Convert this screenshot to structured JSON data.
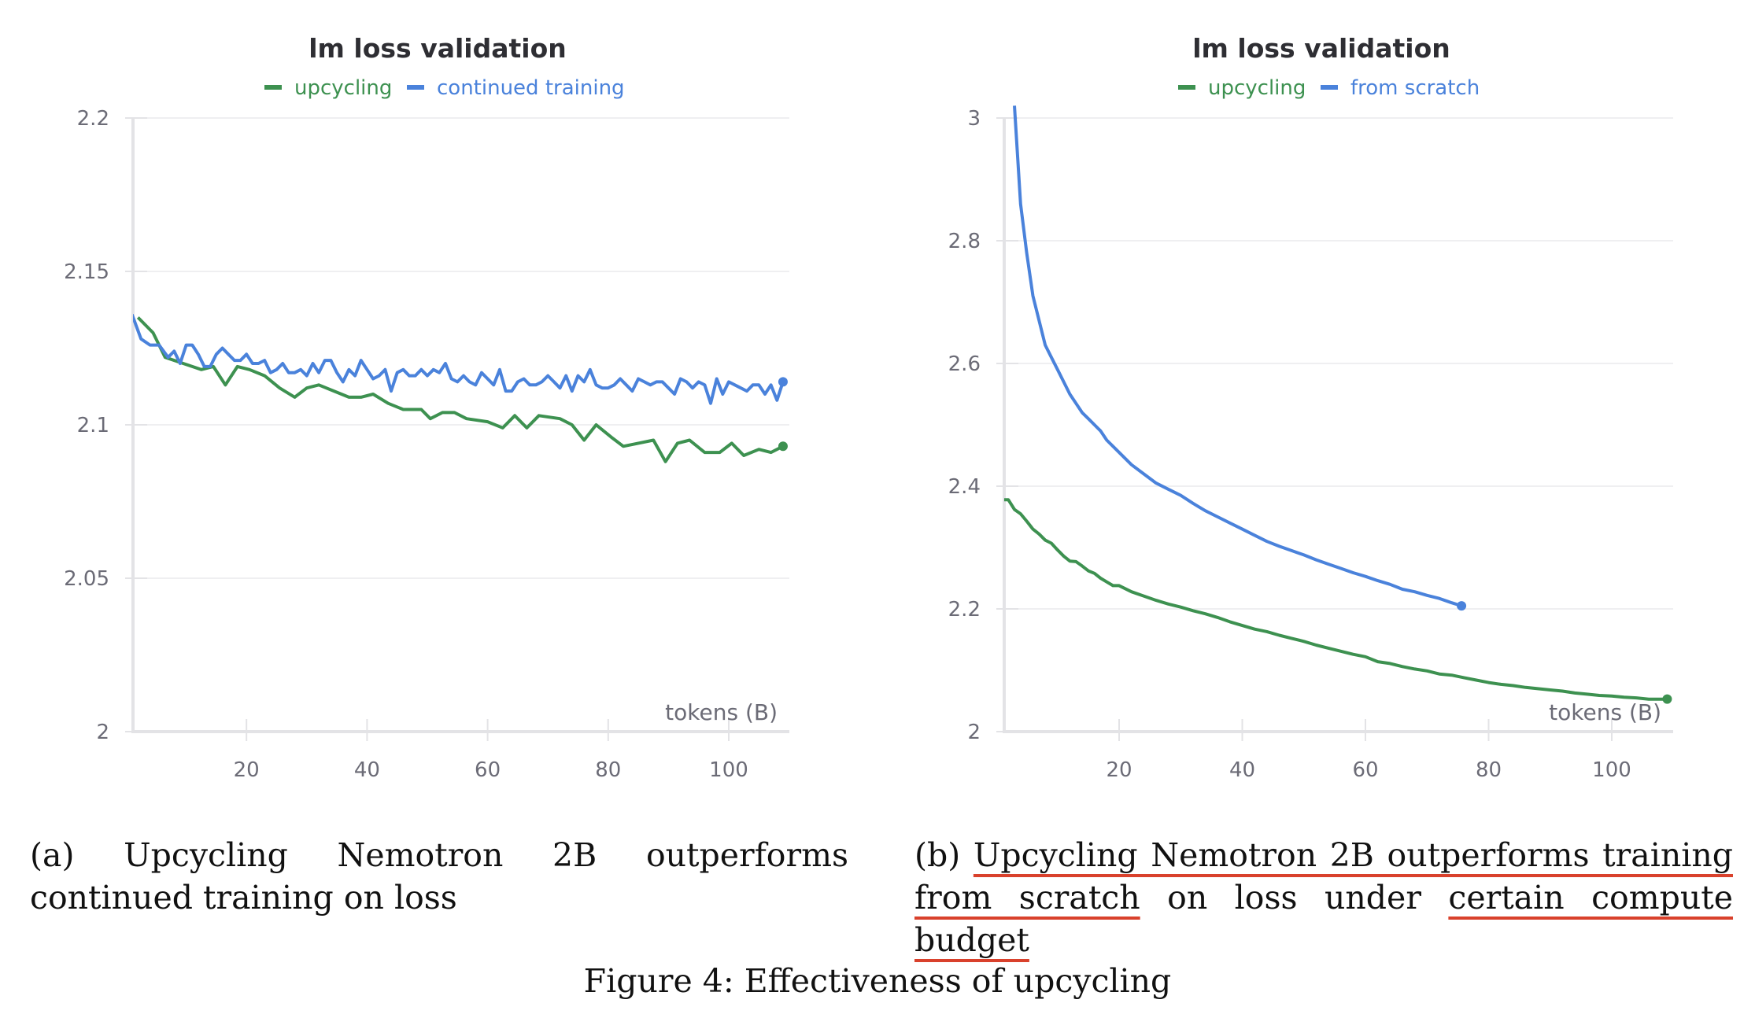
{
  "figure_caption": "Figure 4: Effectiveness of upcycling",
  "subcaptions": [
    {
      "label": "(a)",
      "text": "Upcycling Nemotron 2B outperforms continued training on loss",
      "segments": [
        {
          "text": "Upcycling Nemotron 2B outperforms continued training on loss",
          "underlined": false
        }
      ]
    },
    {
      "label": "(b)",
      "text": "Upcycling Nemotron 2B outperforms training from scratch on loss under certain compute budget",
      "segments": [
        {
          "text": "Upcycling Nemotron 2B outperforms training from scratch",
          "underlined": true
        },
        {
          "text": " on loss under ",
          "underlined": false
        },
        {
          "text": "certain compute budget",
          "underlined": true
        }
      ],
      "underline_color": "#d9412c"
    }
  ],
  "chart_data": [
    {
      "type": "line",
      "title": "lm loss validation",
      "xlabel": "tokens (B)",
      "ylabel": "",
      "xlim": [
        0,
        110
      ],
      "ylim": [
        2.0,
        2.2
      ],
      "xticks": [
        20,
        40,
        60,
        80,
        100
      ],
      "yticks": [
        2.0,
        2.05,
        2.1,
        2.15,
        2.2
      ],
      "ytick_labels": [
        "2",
        "2.05",
        "2.1",
        "2.15",
        "2.2"
      ],
      "grid": true,
      "legend_position": "top-center",
      "series": [
        {
          "name": "upcycling",
          "color": "#3d9150",
          "end_marker": true,
          "x": [
            2,
            4.5,
            6.5,
            9.5,
            12.5,
            14.5,
            16.5,
            18.5,
            20.5,
            23,
            25.5,
            28,
            30,
            32,
            34.5,
            37,
            39,
            41,
            43.5,
            46,
            49,
            50.5,
            52.5,
            54.5,
            56.5,
            60,
            62.5,
            64.5,
            66.5,
            68.5,
            72,
            74,
            76,
            78,
            80.5,
            82.5,
            85,
            87.5,
            89.5,
            91.5,
            93.5,
            96,
            98.5,
            100.5,
            102.5,
            105,
            107,
            109
          ],
          "y": [
            2.135,
            2.13,
            2.122,
            2.12,
            2.118,
            2.119,
            2.113,
            2.119,
            2.118,
            2.116,
            2.112,
            2.109,
            2.112,
            2.113,
            2.111,
            2.109,
            2.109,
            2.11,
            2.107,
            2.105,
            2.105,
            2.102,
            2.104,
            2.104,
            2.102,
            2.101,
            2.099,
            2.103,
            2.099,
            2.103,
            2.102,
            2.1,
            2.095,
            2.1,
            2.096,
            2.093,
            2.094,
            2.095,
            2.088,
            2.094,
            2.095,
            2.091,
            2.091,
            2.094,
            2.09,
            2.092,
            2.091,
            2.093,
            2.088,
            2.087
          ]
        },
        {
          "name": "continued training",
          "color": "#4a82db",
          "end_marker": true,
          "x": [
            1,
            2.5,
            4,
            5.5,
            7,
            8,
            9,
            10,
            11,
            12,
            13,
            14,
            15,
            16,
            17,
            18,
            19,
            20,
            21,
            22,
            23,
            24,
            25,
            26,
            27,
            28,
            29,
            30,
            31,
            32,
            33,
            34,
            35,
            36,
            37,
            38,
            39,
            40,
            41,
            42,
            43,
            44,
            45,
            46,
            47,
            48,
            49,
            50,
            51,
            52,
            53,
            54,
            55,
            56,
            57,
            58,
            59,
            60,
            61,
            62,
            63,
            64,
            65,
            66,
            67,
            68,
            69,
            70,
            71,
            72,
            73,
            74,
            75,
            76,
            77,
            78,
            79,
            80,
            81,
            82,
            83,
            84,
            85,
            86,
            87,
            88,
            89,
            90,
            91,
            92,
            93,
            94,
            95,
            96,
            97,
            98,
            99,
            100,
            101,
            102,
            103,
            104,
            105,
            106,
            107,
            108,
            109
          ],
          "y": [
            2.136,
            2.128,
            2.126,
            2.126,
            2.122,
            2.124,
            2.12,
            2.126,
            2.126,
            2.123,
            2.119,
            2.119,
            2.123,
            2.125,
            2.123,
            2.121,
            2.121,
            2.123,
            2.12,
            2.12,
            2.121,
            2.117,
            2.118,
            2.12,
            2.117,
            2.117,
            2.118,
            2.116,
            2.12,
            2.117,
            2.121,
            2.121,
            2.117,
            2.114,
            2.118,
            2.116,
            2.121,
            2.118,
            2.115,
            2.116,
            2.118,
            2.111,
            2.117,
            2.118,
            2.116,
            2.116,
            2.118,
            2.116,
            2.118,
            2.117,
            2.12,
            2.115,
            2.114,
            2.116,
            2.114,
            2.113,
            2.117,
            2.115,
            2.113,
            2.118,
            2.111,
            2.111,
            2.114,
            2.115,
            2.113,
            2.113,
            2.114,
            2.116,
            2.114,
            2.112,
            2.116,
            2.111,
            2.116,
            2.114,
            2.118,
            2.113,
            2.112,
            2.112,
            2.113,
            2.115,
            2.113,
            2.111,
            2.115,
            2.114,
            2.113,
            2.114,
            2.114,
            2.112,
            2.11,
            2.115,
            2.114,
            2.112,
            2.114,
            2.113,
            2.107,
            2.115,
            2.11,
            2.114,
            2.113,
            2.112,
            2.111,
            2.113,
            2.113,
            2.11,
            2.113,
            2.108,
            2.114,
            2.113
          ]
        }
      ]
    },
    {
      "type": "line",
      "title": "lm loss validation",
      "xlabel": "tokens (B)",
      "ylabel": "",
      "xlim": [
        0,
        110
      ],
      "ylim": [
        2.0,
        3.0
      ],
      "xticks": [
        20,
        40,
        60,
        80,
        100
      ],
      "yticks": [
        2.0,
        2.2,
        2.4,
        2.6,
        2.8,
        3.0
      ],
      "ytick_labels": [
        "2",
        "2.2",
        "2.4",
        "2.6",
        "2.8",
        "3"
      ],
      "grid": true,
      "legend_position": "top-center",
      "series": [
        {
          "name": "upcycling",
          "color": "#3d9150",
          "end_marker": true,
          "x": [
            1,
            2,
            3,
            4,
            5,
            6,
            7,
            8,
            9,
            10,
            11,
            12,
            13,
            14,
            15,
            16,
            17,
            18,
            19,
            20,
            22,
            24,
            26,
            28,
            30,
            32,
            34,
            36,
            38,
            40,
            42,
            44,
            46,
            48,
            50,
            52,
            54,
            56,
            58,
            60,
            62,
            64,
            66,
            68,
            70,
            72,
            74,
            76,
            78,
            80,
            82,
            84,
            86,
            88,
            90,
            92,
            94,
            96,
            98,
            100,
            102,
            104,
            106,
            108,
            109
          ],
          "y": [
            2.378,
            2.378,
            2.362,
            2.355,
            2.343,
            2.33,
            2.322,
            2.312,
            2.307,
            2.296,
            2.286,
            2.278,
            2.277,
            2.27,
            2.262,
            2.258,
            2.25,
            2.244,
            2.238,
            2.238,
            2.228,
            2.221,
            2.214,
            2.208,
            2.203,
            2.197,
            2.192,
            2.186,
            2.179,
            2.173,
            2.167,
            2.163,
            2.157,
            2.152,
            2.147,
            2.141,
            2.136,
            2.131,
            2.126,
            2.122,
            2.114,
            2.111,
            2.106,
            2.102,
            2.099,
            2.094,
            2.092,
            2.088,
            2.084,
            2.08,
            2.077,
            2.075,
            2.072,
            2.07,
            2.068,
            2.066,
            2.063,
            2.061,
            2.059,
            2.058,
            2.056,
            2.055,
            2.053,
            2.053,
            2.053
          ]
        },
        {
          "name": "from scratch",
          "color": "#4a82db",
          "end_marker": true,
          "x": [
            3,
            4,
            5,
            6,
            7,
            8,
            9,
            10,
            11,
            12,
            13,
            14,
            15,
            16,
            17,
            18,
            19,
            20,
            22,
            24,
            26,
            28,
            30,
            32,
            34,
            36,
            38,
            40,
            42,
            44,
            46,
            48,
            50,
            52,
            54,
            56,
            58,
            60,
            62,
            64,
            66,
            68,
            70,
            72,
            74,
            75.6
          ],
          "y": [
            3.02,
            2.86,
            2.78,
            2.71,
            2.67,
            2.63,
            2.61,
            2.59,
            2.57,
            2.55,
            2.535,
            2.52,
            2.51,
            2.5,
            2.49,
            2.475,
            2.465,
            2.455,
            2.435,
            2.42,
            2.405,
            2.395,
            2.385,
            2.372,
            2.36,
            2.35,
            2.34,
            2.33,
            2.32,
            2.31,
            2.302,
            2.295,
            2.288,
            2.28,
            2.273,
            2.266,
            2.259,
            2.253,
            2.246,
            2.24,
            2.232,
            2.228,
            2.222,
            2.217,
            2.21,
            2.205
          ]
        }
      ]
    }
  ]
}
